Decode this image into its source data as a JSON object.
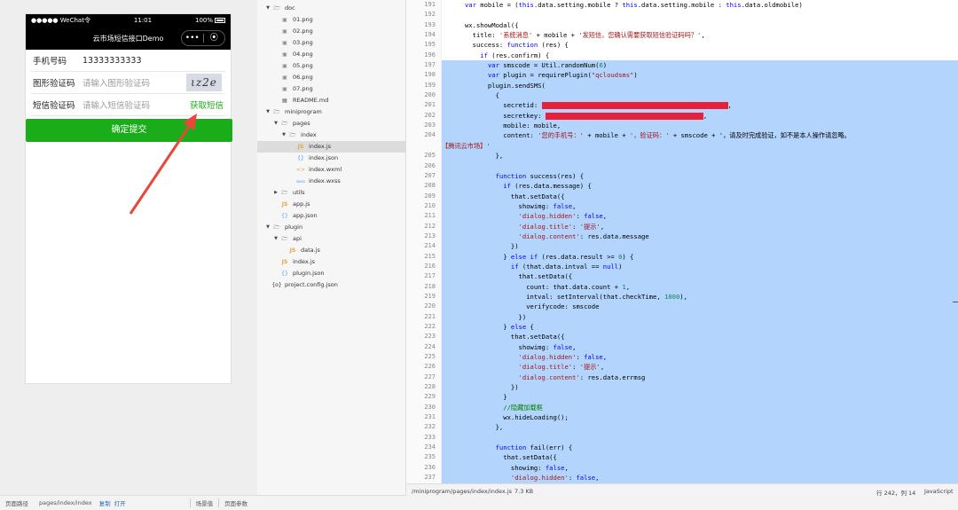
{
  "simulator": {
    "status_left": "●●●●● WeChat令",
    "time": "11:01",
    "battery": "100%",
    "nav_title": "云市场短信接口Demo",
    "capsule_more": "•••",
    "capsule_close": "⦿",
    "rows": {
      "phone_label": "手机号码",
      "phone_value": "13333333333",
      "captcha_label": "图形验证码",
      "captcha_placeholder": "请输入图形验证码",
      "captcha_text": "ιz2e",
      "sms_label": "短信验证码",
      "sms_placeholder": "请输入短信验证码",
      "sms_button": "获取短信"
    },
    "submit": "确定提交",
    "arrow_color": "#e8473c"
  },
  "tree": [
    {
      "depth": 0,
      "caret": "▼",
      "icon": "folder",
      "label": "doc"
    },
    {
      "depth": 1,
      "icon": "png",
      "label": "01.png"
    },
    {
      "depth": 1,
      "icon": "png",
      "label": "02.png"
    },
    {
      "depth": 1,
      "icon": "png",
      "label": "03.png"
    },
    {
      "depth": 1,
      "icon": "png",
      "label": "04.png"
    },
    {
      "depth": 1,
      "icon": "png",
      "label": "05.png"
    },
    {
      "depth": 1,
      "icon": "png",
      "label": "06.png"
    },
    {
      "depth": 1,
      "icon": "png",
      "label": "07.png"
    },
    {
      "depth": 1,
      "icon": "md",
      "label": "README.md"
    },
    {
      "depth": 0,
      "caret": "▼",
      "icon": "folder",
      "label": "miniprogram"
    },
    {
      "depth": 1,
      "caret": "▼",
      "icon": "folder",
      "label": "pages"
    },
    {
      "depth": 2,
      "caret": "▼",
      "icon": "folder",
      "label": "index"
    },
    {
      "depth": 3,
      "icon": "js",
      "label": "index.js",
      "selected": true
    },
    {
      "depth": 3,
      "icon": "json",
      "label": "index.json"
    },
    {
      "depth": 3,
      "icon": "wxml",
      "label": "index.wxml"
    },
    {
      "depth": 3,
      "icon": "wxss",
      "label": "index.wxss"
    },
    {
      "depth": 1,
      "caret": "▶",
      "icon": "folder",
      "label": "utils"
    },
    {
      "depth": 1,
      "icon": "js",
      "label": "app.js"
    },
    {
      "depth": 1,
      "icon": "json",
      "label": "app.json"
    },
    {
      "depth": 0,
      "caret": "▼",
      "icon": "folder",
      "label": "plugin"
    },
    {
      "depth": 1,
      "caret": "▼",
      "icon": "folder",
      "label": "api"
    },
    {
      "depth": 2,
      "icon": "js",
      "label": "data.js"
    },
    {
      "depth": 1,
      "icon": "js",
      "label": "index.js"
    },
    {
      "depth": 1,
      "icon": "json",
      "label": "plugin.json"
    },
    {
      "depth": 0,
      "icon": "config",
      "label": "project.config.json"
    }
  ],
  "code_lines": [
    {
      "n": "191",
      "hl": false,
      "t": "      var mobile = (this.data.setting.mobile ? this.data.setting.mobile : this.data.oldmobile)"
    },
    {
      "n": "192",
      "hl": false,
      "t": ""
    },
    {
      "n": "193",
      "hl": false,
      "t": "      wx.showModal({"
    },
    {
      "n": "194",
      "hl": false,
      "t": "        title: '系统消息' + mobile + '发短信，您确认需要获取短信验证码吗？',"
    },
    {
      "n": "195",
      "hl": false,
      "t": "        success: function (res) {"
    },
    {
      "n": "196",
      "hl": false,
      "t": "          if (res.confirm) {"
    },
    {
      "n": "197",
      "hl": true,
      "t": "            var smscode = Util.randomNum(6)"
    },
    {
      "n": "198",
      "hl": true,
      "t": "            var plugin = requirePlugin(\"qcloudsms\")"
    },
    {
      "n": "199",
      "hl": true,
      "t": "            plugin.sendSMS("
    },
    {
      "n": "200",
      "hl": true,
      "t": "              {"
    },
    {
      "n": "201",
      "hl": true,
      "t": "                secretid: ",
      "redact": 210
    },
    {
      "n": "202",
      "hl": true,
      "t": "                secretkey: ",
      "redact": 178
    },
    {
      "n": "203",
      "hl": true,
      "t": "                mobile: mobile,"
    },
    {
      "n": "204",
      "hl": true,
      "t": "                content: '您的手机号：' + mobile + '，验证码：' + smscode + '，请及时完成验证，如不是本人操作请忽略。"
    },
    {
      "n": "",
      "hl": true,
      "t": "【腾讯云市场】'"
    },
    {
      "n": "205",
      "hl": true,
      "t": "              },"
    },
    {
      "n": "206",
      "hl": true,
      "t": ""
    },
    {
      "n": "207",
      "hl": true,
      "t": "              function success(res) {"
    },
    {
      "n": "208",
      "hl": true,
      "t": "                if (res.data.message) {"
    },
    {
      "n": "209",
      "hl": true,
      "t": "                  that.setData({"
    },
    {
      "n": "210",
      "hl": true,
      "t": "                    showimg: false,"
    },
    {
      "n": "211",
      "hl": true,
      "t": "                    'dialog.hidden': false,"
    },
    {
      "n": "212",
      "hl": true,
      "t": "                    'dialog.title': '提示',"
    },
    {
      "n": "213",
      "hl": true,
      "t": "                    'dialog.content': res.data.message"
    },
    {
      "n": "214",
      "hl": true,
      "t": "                  })"
    },
    {
      "n": "215",
      "hl": true,
      "t": "                } else if (res.data.result >= 0) {"
    },
    {
      "n": "216",
      "hl": true,
      "t": "                  if (that.data.intval == null)"
    },
    {
      "n": "217",
      "hl": true,
      "t": "                    that.setData({"
    },
    {
      "n": "218",
      "hl": true,
      "t": "                      count: that.data.count + 1,"
    },
    {
      "n": "219",
      "hl": true,
      "t": "                      intval: setInterval(that.checkTime, 1000),"
    },
    {
      "n": "220",
      "hl": true,
      "t": "                      verifycode: smscode"
    },
    {
      "n": "221",
      "hl": true,
      "t": "                    })"
    },
    {
      "n": "222",
      "hl": true,
      "t": "                } else {"
    },
    {
      "n": "223",
      "hl": true,
      "t": "                  that.setData({"
    },
    {
      "n": "224",
      "hl": true,
      "t": "                    showimg: false,"
    },
    {
      "n": "225",
      "hl": true,
      "t": "                    'dialog.hidden': false,"
    },
    {
      "n": "226",
      "hl": true,
      "t": "                    'dialog.title': '提示',"
    },
    {
      "n": "227",
      "hl": true,
      "t": "                    'dialog.content': res.data.errmsg"
    },
    {
      "n": "228",
      "hl": true,
      "t": "                  })"
    },
    {
      "n": "229",
      "hl": true,
      "t": "                }"
    },
    {
      "n": "230",
      "hl": true,
      "t": "                //隐藏加载框"
    },
    {
      "n": "231",
      "hl": true,
      "t": "                wx.hideLoading();"
    },
    {
      "n": "232",
      "hl": true,
      "t": "              },"
    },
    {
      "n": "233",
      "hl": true,
      "t": ""
    },
    {
      "n": "234",
      "hl": true,
      "t": "              function fail(err) {"
    },
    {
      "n": "235",
      "hl": true,
      "t": "                that.setData({"
    },
    {
      "n": "236",
      "hl": true,
      "t": "                  showimg: false,"
    },
    {
      "n": "237",
      "hl": true,
      "t": "                  'dialog.hidden': false,"
    }
  ],
  "footer_left": {
    "path_label": "页面路径",
    "path": "pages/index/index",
    "copy": "复制",
    "open": "打开",
    "scene": "场景值",
    "params": "页面参数"
  },
  "footer_right": {
    "file": "/miniprogram/pages/index/index.js",
    "size": "7.3 KB",
    "position": "行 242，列 14",
    "language": "JavaScript"
  },
  "colors": {
    "wechat_green": "#1aad19",
    "selection": "#b3d4fc",
    "redaction": "#e8213a"
  }
}
